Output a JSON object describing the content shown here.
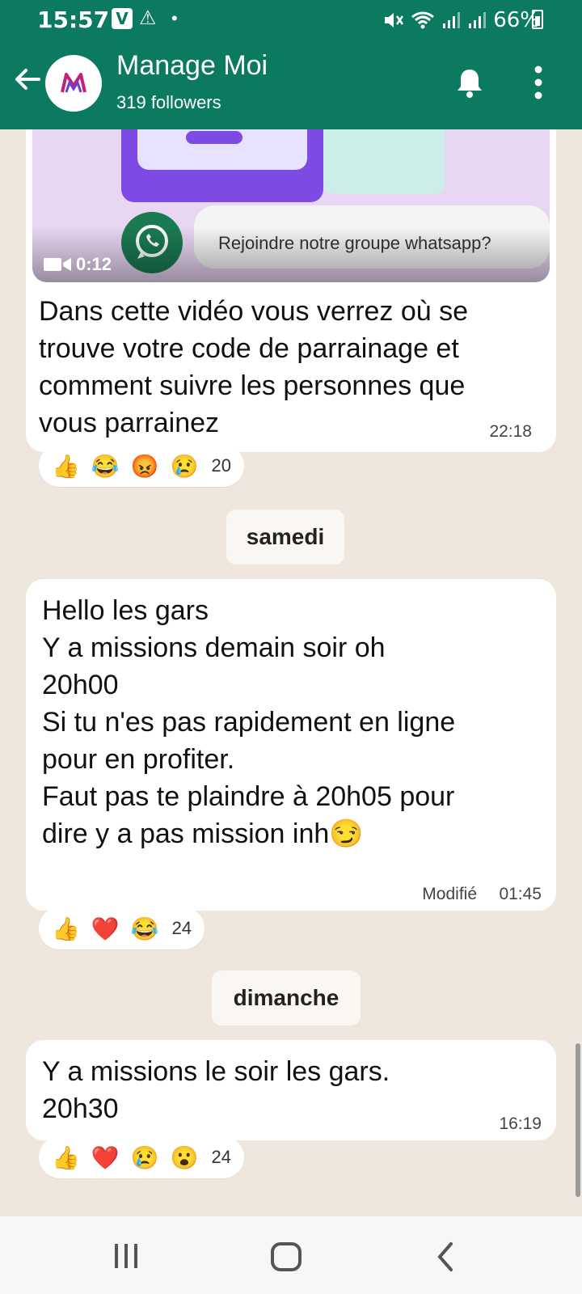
{
  "status_bar": {
    "time": "15:57",
    "app_badge": "V",
    "battery": "66%"
  },
  "header": {
    "channel_name": "Manage Moi",
    "followers": "319 followers"
  },
  "messages": [
    {
      "video_caption": "Rejoindre notre groupe whatsapp?",
      "video_duration": "0:12",
      "text": "Dans cette vidéo vous verrez où se\ntrouve votre code de parrainage et\ncomment suivre les personnes que\nvous parrainez",
      "time": "22:18",
      "reactions": [
        "👍",
        "😂",
        "😡",
        "😢"
      ],
      "reaction_count": "20"
    },
    {
      "date_label": "samedi",
      "text": "Hello les gars\nY a missions demain soir oh\n20h00\nSi tu n'es pas rapidement en ligne\npour en profiter.\nFaut pas te plaindre à 20h05 pour\ndire y a pas mission inh😏",
      "edited_label": "Modifié",
      "time": "01:45",
      "reactions": [
        "👍",
        "❤️",
        "😂"
      ],
      "reaction_count": "24"
    },
    {
      "date_label": "dimanche",
      "text": "Y a missions le soir les gars.\n20h30",
      "time": "16:19",
      "reactions": [
        "👍",
        "❤️",
        "😢",
        "😮"
      ],
      "reaction_count": "24"
    }
  ],
  "colors": {
    "header": "#0b7a61",
    "chat_bg": "#efe7dd",
    "bubble": "#ffffff"
  }
}
